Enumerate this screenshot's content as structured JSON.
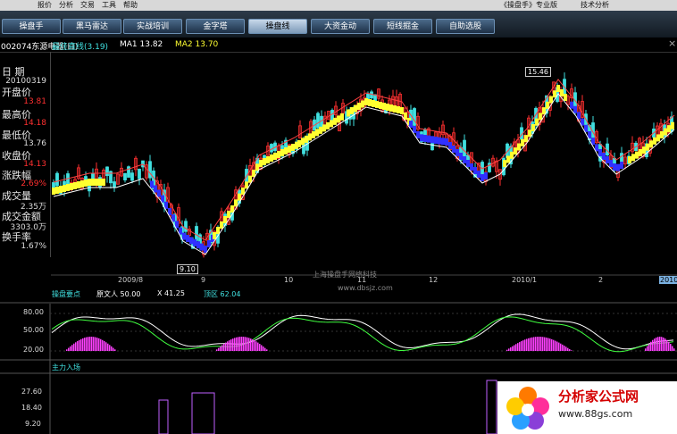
{
  "window": {
    "menu_items": [
      "报价",
      "分析",
      "交易",
      "工具",
      "帮助"
    ],
    "title": "《操盘手》专业版",
    "tech_support": "技术分析"
  },
  "toolbar": {
    "buttons": [
      {
        "label": "操盘手",
        "active": false
      },
      {
        "label": "黑马雷达",
        "active": false
      },
      {
        "label": "实战培训",
        "active": false
      },
      {
        "label": "金字塔",
        "active": false
      },
      {
        "label": "操盘线",
        "active": true
      },
      {
        "label": "大资金动",
        "active": false
      },
      {
        "label": "短线掘金",
        "active": false
      },
      {
        "label": "自助选股",
        "active": false
      }
    ]
  },
  "stock": {
    "code_name": "002074东源电器(日)",
    "best_line": "最佳直线(3.19)",
    "ma1": "MA1 13.82",
    "ma2": "MA2 13.70"
  },
  "quote_panel": {
    "date_label": "日 期",
    "date_value": "20100319",
    "open_label": "开盘价",
    "open_value": "13.81",
    "high_label": "最高价",
    "high_value": "14.18",
    "low_label": "最低价",
    "low_value": "13.76",
    "close_label": "收盘价",
    "close_value": "14.13",
    "change_label": "涨跌幅",
    "change_value": "2.69%",
    "volume_label": "成交量",
    "volume_value": "2.35万",
    "amount_label": "成交金额",
    "amount_value": "3303.0万",
    "turnover_label": "换手率",
    "turnover_value": "1.67%"
  },
  "main_chart": {
    "high_marker": "15.46",
    "low_marker": "9.10",
    "x_labels": [
      "2009/8",
      "9",
      "10",
      "11",
      "12",
      "2010/1",
      "2",
      "2010"
    ],
    "watermark": "上海操盘手网络科技",
    "watermark_url": "www.dbsjz.com"
  },
  "indicator1": {
    "title": "操盘要点",
    "v1": "原文人 50.00",
    "v2": "X 41.25",
    "v3": "顶区 62.04",
    "y_labels": [
      "80.00",
      "50.00",
      "20.00"
    ]
  },
  "indicator2": {
    "title": "主力入场",
    "y_labels": [
      "27.60",
      "18.40",
      "9.20"
    ]
  },
  "brand": {
    "name": "分析家公式网",
    "url": "www.88gs.com"
  },
  "colors": {
    "up": "#ff3030",
    "down": "#40e0e0",
    "yellow_band": "#ffff30",
    "blue_band": "#3030ff",
    "accent_green": "#40ff40",
    "magenta": "#ff40ff"
  }
}
